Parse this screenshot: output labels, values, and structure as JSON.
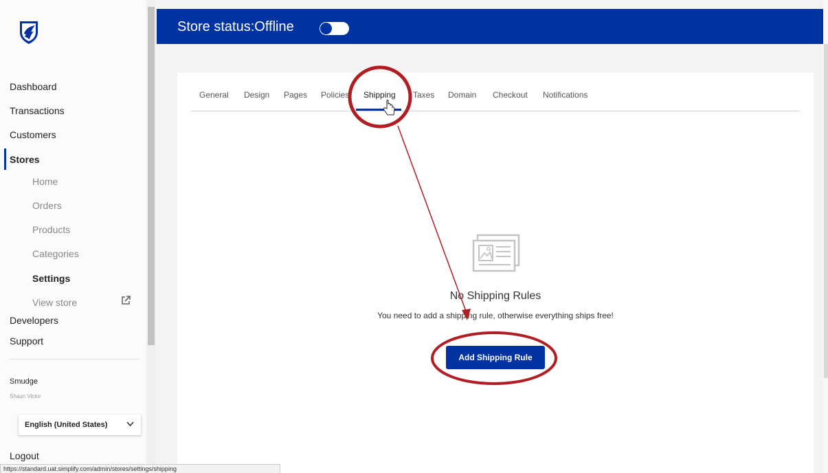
{
  "sidebar": {
    "logo_icon": "shield-logo-icon",
    "nav": {
      "dashboard": "Dashboard",
      "transactions": "Transactions",
      "customers": "Customers",
      "stores": "Stores",
      "home": "Home",
      "orders": "Orders",
      "products": "Products",
      "categories": "Categories",
      "settings": "Settings",
      "view_store": "View store",
      "developers": "Developers",
      "support": "Support"
    },
    "external_icon": "external-link-icon",
    "user_name": "Smudge",
    "user_sub": "Shaun Victor",
    "language": "English (United States)",
    "logout": "Logout"
  },
  "header": {
    "title": "Store status:Offline",
    "toggle_state": "off"
  },
  "tabs": [
    "General",
    "Design",
    "Pages",
    "Policies",
    "Shipping",
    "Taxes",
    "Domain",
    "Checkout",
    "Notifications"
  ],
  "active_tab": "Shipping",
  "empty_state": {
    "icon": "document-image-icon",
    "title": "No Shipping Rules",
    "description": "You need to add a shipping rule, otherwise everything ships free!",
    "button": "Add Shipping Rule"
  },
  "status_bar": {
    "url": "https://standard.uat.simplify.com/admin/stores/settings/shipping"
  },
  "colors": {
    "primary": "#0033a1",
    "annotation": "#b01e23"
  }
}
